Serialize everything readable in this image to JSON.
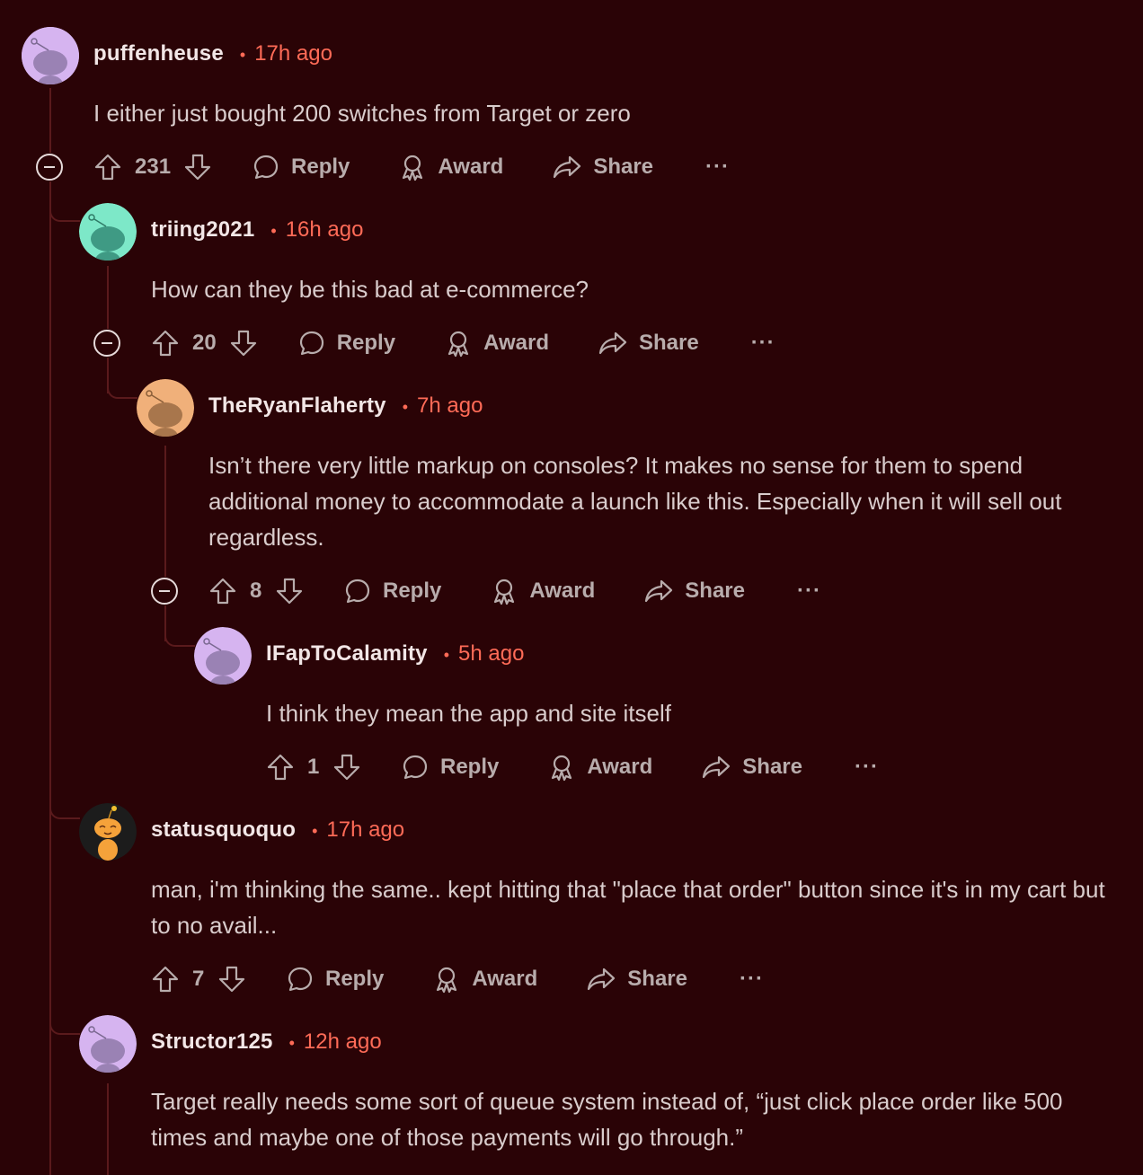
{
  "colors": {
    "background": "#2a0306",
    "accent_time": "#ff6b57",
    "thread_line": "#5a1a1c"
  },
  "actions": {
    "reply": "Reply",
    "award": "Award",
    "share": "Share",
    "more": "···"
  },
  "comments": [
    {
      "username": "puffenheuse",
      "time": "17h ago",
      "body": "I either just bought 200 switches from Target or zero",
      "votes": "231",
      "avatar": "snoo-avatar-lavender"
    },
    {
      "username": "triing2021",
      "time": "16h ago",
      "body": "How can they be this bad at e-commerce?",
      "votes": "20",
      "avatar": "snoo-avatar-mint"
    },
    {
      "username": "TheRyanFlaherty",
      "time": "7h ago",
      "body": "Isn’t there very little markup on consoles? It makes no sense for them to spend additional money to accommodate a launch like this. Especially when it will sell out regardless.",
      "votes": "8",
      "avatar": "snoo-avatar-orange"
    },
    {
      "username": "IFapToCalamity",
      "time": "5h ago",
      "body": "I think they mean the app and site itself",
      "votes": "1",
      "avatar": "snoo-avatar-lavender"
    },
    {
      "username": "statusquoquo",
      "time": "17h ago",
      "body": "man, i'm thinking the same.. kept hitting that \"place that order\" button since it's in my cart but to no avail...",
      "votes": "7",
      "avatar": "custom-snoo-avatar"
    },
    {
      "username": "Structor125",
      "time": "12h ago",
      "body": "Target really needs some sort of queue system instead of, “just click place order like 500 times and maybe one of those payments will go through.”",
      "avatar": "snoo-avatar-lavender"
    }
  ]
}
